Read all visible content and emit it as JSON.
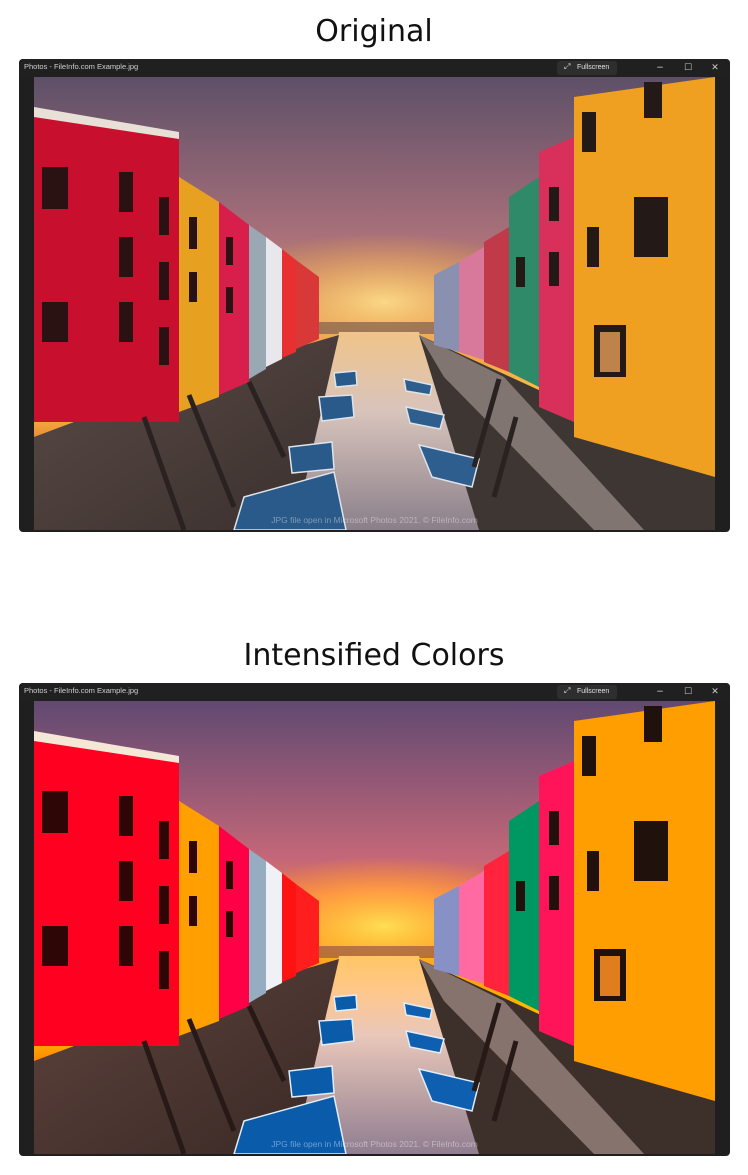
{
  "panels": {
    "top": {
      "title": "Original",
      "window_title": "Photos - FileInfo.com Example.jpg",
      "fullscreen_label": "Fullscreen",
      "watermark": "JPG file open in Microsoft Photos 2021. © FileInfo.com"
    },
    "bottom": {
      "title": "Intensified Colors",
      "window_title": "Photos - FileInfo.com Example.jpg",
      "fullscreen_label": "Fullscreen",
      "watermark": "JPG file open in Microsoft Photos 2021. © FileInfo.com"
    }
  },
  "window_controls": {
    "minimize": "−",
    "maximize": "☐",
    "close": "✕",
    "fullscreen_icon": "⤢"
  },
  "icons": [
    "expand-icon",
    "minimize-icon",
    "maximize-icon",
    "close-icon"
  ],
  "colors": {
    "window_bg": "#1f1f1f",
    "sky_top": "#6a5a74",
    "sun": "#f7b733",
    "canal": "#cfc6c3"
  }
}
